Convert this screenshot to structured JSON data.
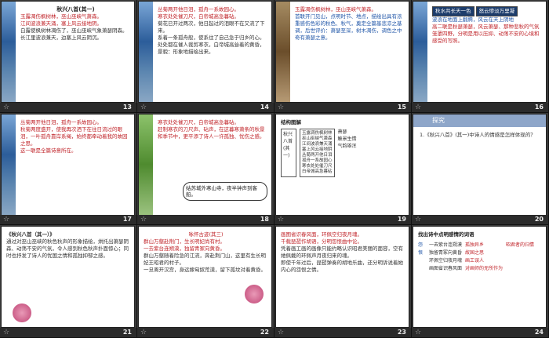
{
  "slides": [
    {
      "n": "13",
      "t": "秋兴八首(其一)",
      "lines": [
        "玉露凋伤枫树林，巫山巫峡气萧森。",
        "江间波浪兼天涌，塞上风云接地阴。",
        "白露使枫树林凋伤了，巫山巫峡气象萧瑟阴森。",
        "长江里波浪兼天，边塞上风云阴沉。"
      ]
    },
    {
      "n": "14",
      "t": "丛菊两开他日泪，孤舟一系故园心。",
      "lines": [
        "寒衣处处催刀尺，白帝城高急暮砧。",
        "菊花已开过两次，他日起过的泪眼不在又流了下来。",
        "系着一条孤舟般，使系住了自己急于归乡的心。",
        "处处都在催人裁剪寒衣，白帝城高耸着的黄昏，",
        "景貌：形象地描绘出来。"
      ]
    },
    {
      "n": "15",
      "t": "玉露凋伤枫树林，巫山巫峡气萧森。",
      "lines": [
        "首联开门见山，点明时节、地点，描绘出具有浓重感伤色彩的秋色、秋气，奠定全篇基悲凉之基调，后世评价：萧瑟至深，树木凋伤，调色之中奇有萧瑟之意。"
      ]
    },
    {
      "n": "16",
      "t": "秋水共长天一色",
      "sub": "怒云惨淡万里凝",
      "lines": [
        "波浪在地面上翻腾，风云在天上阴地",
        "高二联是秋瑟萧瑟，风云萧瑟、那种悲秋的气氛笼罩四野，分明是用以压抑、动荡不安的心境和感受的写照。"
      ]
    },
    {
      "n": "17",
      "t": "丛菊两开他日泪，孤舟一系故园心。",
      "lines": [
        "秋菊两度盛开，使我再次洒下在往日流过的眼泪，一叶孤舟靠岸系绳，始终都牵动着我的故园之思。",
        "这一联是全篇诗意所在。"
      ]
    },
    {
      "n": "18",
      "t": "寒衣处处催刀尺，白帝城高急暮砧。",
      "lines": [
        "赶制寒衣的刀尺声、砧声，在这暮寒萧条的秋景和季节中，更平添了诗人一许孤独、忧伤之感。"
      ],
      "bubble": "姑苏城外寒山寺，夜半钟声到客船。"
    },
    {
      "n": "19",
      "t": "结构图解",
      "lines": [
        "秋兴八首(其一)",
        "玉露凋伤枫树林",
        "巫山巫峡气萧森",
        "江间波浪兼天涌",
        "塞上风云接地阴",
        "丛菊两开他日泪",
        "孤舟一系故园心",
        "寒衣处处催刀尺",
        "白帝城高急暮砧",
        "萧瑟",
        "触景生情",
        "气韵雄浑"
      ]
    },
    {
      "n": "20",
      "t": "探究",
      "lines": [
        "1.《秋兴八首》(其一)中诗人的情感是怎样体现的？"
      ]
    },
    {
      "n": "21",
      "t": "《秋兴八首（其一）》",
      "lines": [
        "通过对巫山巫峡的秋色秋声的形象描绘，烘托出萧瑟阴森、动荡不安的气氛，令人感到秋色秋声扑面惊心；同时也抒发了诗人的忧国之情和孤独抑郁之感。"
      ]
    },
    {
      "n": "22",
      "t": "咏怀古迹(其三)",
      "lines": [
        "群山万壑赴荆门，生长明妃尚有村。",
        "一去紫台连朔漠，独留青冢向黄昏。",
        "群山万壑随着险急的江流，奔赴荆门山，这里有生长明妃王昭君的村子。",
        "一旦离开汉宫，身远嫁匈奴荒漠，留下孤坟对着黄昏。"
      ]
    },
    {
      "n": "23",
      "t": "画图省识春风面，环佩空归夜月魂。",
      "lines": [
        "千载琵琶作胡语，分明怨恨曲中论。",
        "凭着画工画的画像只能约略认识昭君美丽的面容，空有她佩戴的环佩声月夜归来的魂。",
        "即使千年过后，琵琶弹奏的胡地乐曲，还分明诉说着她内心的怨恨之情。"
      ]
    },
    {
      "n": "24",
      "t": "找出诗中点明感情的词语",
      "lines": [
        "一去紫台连朔漠",
        "独留青冢向黄昏",
        "环佩空归夜月魂",
        "画图省识春风面",
        "怨恨",
        "孤独异乡",
        "故国之思",
        "画工误人",
        "对画师的无所作为",
        "昭君者的归情",
        "悲恨"
      ]
    }
  ]
}
